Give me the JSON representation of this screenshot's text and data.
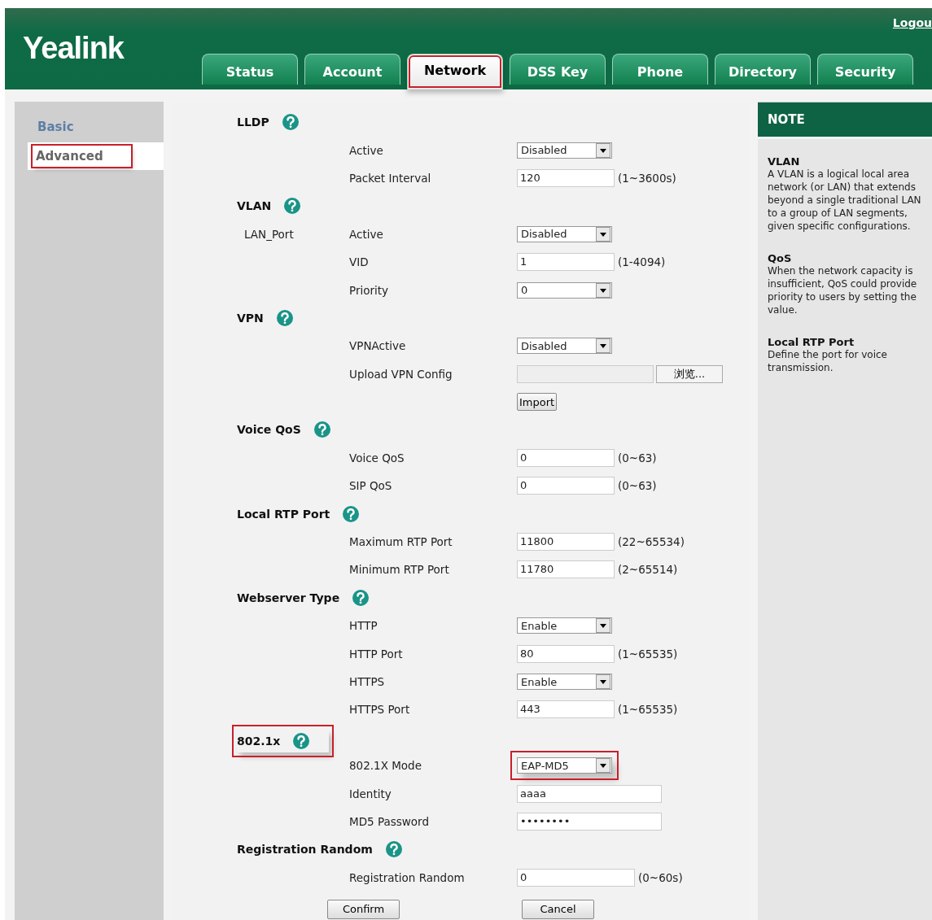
{
  "header": {
    "logo": "Yealink",
    "logout": "Logou"
  },
  "tabs": [
    {
      "label": "Status",
      "selected": false,
      "highlighted": false
    },
    {
      "label": "Account",
      "selected": false,
      "highlighted": false
    },
    {
      "label": "Network",
      "selected": true,
      "highlighted": true
    },
    {
      "label": "DSS Key",
      "selected": false,
      "highlighted": false
    },
    {
      "label": "Phone",
      "selected": false,
      "highlighted": false
    },
    {
      "label": "Directory",
      "selected": false,
      "highlighted": false
    },
    {
      "label": "Security",
      "selected": false,
      "highlighted": false
    }
  ],
  "sidebar": {
    "items": [
      {
        "label": "Basic",
        "selected": false,
        "highlighted": false
      },
      {
        "label": "Advanced",
        "selected": true,
        "highlighted": true
      }
    ]
  },
  "sections": [
    {
      "title": "LLDP",
      "highlighted": false,
      "rows": [
        {
          "label": "Active",
          "kind": "select",
          "value": "Disabled"
        },
        {
          "label": "Packet Interval",
          "kind": "text",
          "value": "120",
          "hint": "(1~3600s)"
        }
      ]
    },
    {
      "title": "VLAN",
      "highlighted": false,
      "rows": [
        {
          "group": "LAN_Port",
          "label": "Active",
          "kind": "select",
          "value": "Disabled"
        },
        {
          "label": "VID",
          "kind": "text",
          "value": "1",
          "hint": "(1-4094)"
        },
        {
          "label": "Priority",
          "kind": "select",
          "value": "0"
        }
      ]
    },
    {
      "title": "VPN",
      "highlighted": false,
      "rows": [
        {
          "label": "VPNActive",
          "kind": "select",
          "value": "Disabled"
        },
        {
          "label": "Upload VPN Config",
          "kind": "file",
          "button": "浏览..."
        },
        {
          "kind": "button",
          "button": "Import"
        }
      ]
    },
    {
      "title": "Voice QoS",
      "highlighted": false,
      "rows": [
        {
          "label": "Voice QoS",
          "kind": "text",
          "value": "0",
          "hint": "(0~63)"
        },
        {
          "label": "SIP QoS",
          "kind": "text",
          "value": "0",
          "hint": "(0~63)"
        }
      ]
    },
    {
      "title": "Local RTP Port",
      "highlighted": false,
      "rows": [
        {
          "label": "Maximum RTP Port",
          "kind": "text",
          "value": "11800",
          "hint": "(22~65534)"
        },
        {
          "label": "Minimum RTP Port",
          "kind": "text",
          "value": "11780",
          "hint": "(2~65514)"
        }
      ]
    },
    {
      "title": "Webserver Type",
      "highlighted": false,
      "rows": [
        {
          "label": "HTTP",
          "kind": "select",
          "value": "Enable"
        },
        {
          "label": "HTTP Port",
          "kind": "text",
          "value": "80",
          "hint": "(1~65535)"
        },
        {
          "label": "HTTPS",
          "kind": "select",
          "value": "Enable"
        },
        {
          "label": "HTTPS Port",
          "kind": "text",
          "value": "443",
          "hint": "(1~65535)"
        }
      ]
    },
    {
      "title": "802.1x",
      "highlighted": true,
      "rows": [
        {
          "label": "802.1X Mode",
          "kind": "select",
          "value": "EAP-MD5",
          "highlighted": true
        },
        {
          "label": "Identity",
          "kind": "wide",
          "value": "aaaa"
        },
        {
          "label": "MD5 Password",
          "kind": "password",
          "value": "••••••••"
        }
      ]
    },
    {
      "title": "Registration Random",
      "highlighted": false,
      "rows": [
        {
          "label": "Registration Random",
          "kind": "medium",
          "value": "0",
          "hint": "(0~60s)"
        }
      ]
    }
  ],
  "buttons": [
    "Confirm",
    "Cancel"
  ],
  "note": {
    "title": "NOTE",
    "entries": [
      {
        "heading": "VLAN",
        "text": "A VLAN is a logical local area network (or LAN) that extends beyond a single traditional LAN to a group of LAN segments, given specific configurations."
      },
      {
        "heading": "QoS",
        "text": "When the network capacity is insufficient, QoS could provide priority to users by setting the value."
      },
      {
        "heading": "Local RTP Port",
        "text": "Define the port for voice transmission."
      }
    ]
  }
}
